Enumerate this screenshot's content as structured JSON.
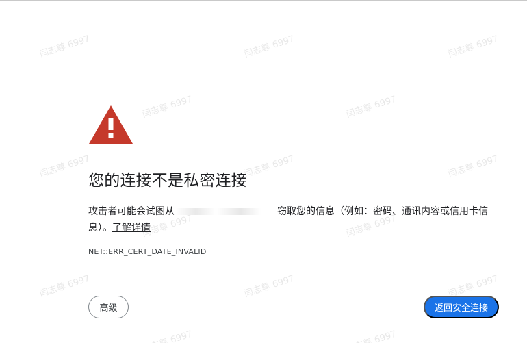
{
  "watermark": "闫志尊 6997",
  "warning": {
    "icon": "warning-triangle-icon",
    "color": "#c5392b"
  },
  "title": "您的连接不是私密连接",
  "description": {
    "before": "攻击者可能会试图从",
    "after": "窃取您的信息（例如：密码、通讯内容或信用卡信息）。",
    "learn_more": "了解详情"
  },
  "error_code": "NET::ERR_CERT_DATE_INVALID",
  "buttons": {
    "advanced": "高级",
    "back_to_safety": "返回安全连接"
  },
  "colors": {
    "primary_button": "#1a73e8",
    "text": "#202124"
  }
}
